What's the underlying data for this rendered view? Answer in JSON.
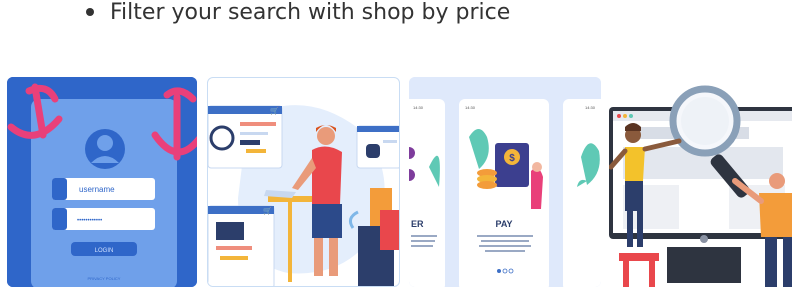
{
  "bullet": {
    "text": "Filter your search with shop by price"
  },
  "login_card": {
    "username_label": "username",
    "password_mask": "••••••••••••",
    "login_label": "LOGIN",
    "privacy_label": "PRIVACY POLICY"
  },
  "mobile_card": {
    "left_screen_title": "ER",
    "center_screen_title": "PAY",
    "status_time": "14:30",
    "currency_symbol": "$"
  },
  "colors": {
    "brand_blue": "#2f66c9",
    "accent_pink": "#e9407a",
    "accent_orange": "#f39c3a",
    "accent_teal": "#5fc9b5"
  },
  "icons": [
    "lock-icon",
    "user-avatar-icon",
    "cart-icon",
    "magnifier-icon",
    "dollar-icon",
    "anchor-icon"
  ]
}
